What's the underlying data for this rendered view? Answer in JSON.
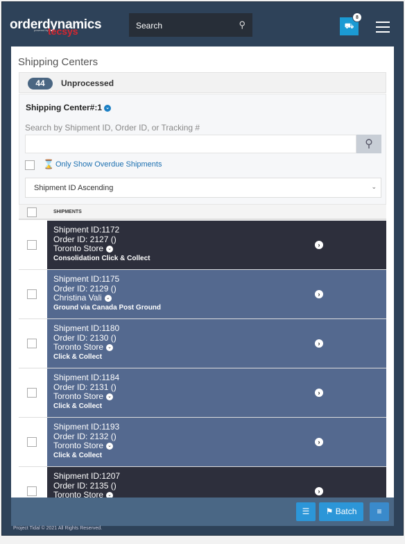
{
  "header": {
    "logo": "orderdynamics",
    "logo_sub": "powered by",
    "logo_brand": "tecsys",
    "search_placeholder": "Search",
    "truck_badge": "8"
  },
  "page": {
    "title": "Shipping Centers",
    "tab_count": "44",
    "tab_label": "Unprocessed"
  },
  "filters": {
    "center": "Shipping Center#:1",
    "search_label": "Search by Shipment ID, Order ID, or Tracking #",
    "search_value": "",
    "overdue_label": "Only Show Overdue Shipments",
    "sort": "Shipment ID Ascending"
  },
  "table": {
    "header": "SHIPMENTS",
    "rows": [
      {
        "shipment": "Shipment ID:1172",
        "order": "Order ID: 2127 ()",
        "location": "Toronto Store",
        "method": "Consolidation Click & Collect",
        "color": "#2d2f3c"
      },
      {
        "shipment": "Shipment ID:1175",
        "order": "Order ID: 2129 ()",
        "location": "Christina Vali",
        "method": "Ground via Canada Post Ground",
        "color": "#54698f"
      },
      {
        "shipment": "Shipment ID:1180",
        "order": "Order ID: 2130 ()",
        "location": "Toronto Store",
        "method": "Click & Collect",
        "color": "#54698f"
      },
      {
        "shipment": "Shipment ID:1184",
        "order": "Order ID: 2131 ()",
        "location": "Toronto Store",
        "method": "Click & Collect",
        "color": "#54698f"
      },
      {
        "shipment": "Shipment ID:1193",
        "order": "Order ID: 2132 ()",
        "location": "Toronto Store",
        "method": "Click & Collect",
        "color": "#54698f"
      },
      {
        "shipment": "Shipment ID:1207",
        "order": "Order ID: 2135 ()",
        "location": "Toronto Store",
        "method": "",
        "color": "#2d2f3c"
      }
    ]
  },
  "bottom": {
    "batch": "Batch"
  },
  "footer": "Project Tidal © 2021 All Rights Reserved."
}
